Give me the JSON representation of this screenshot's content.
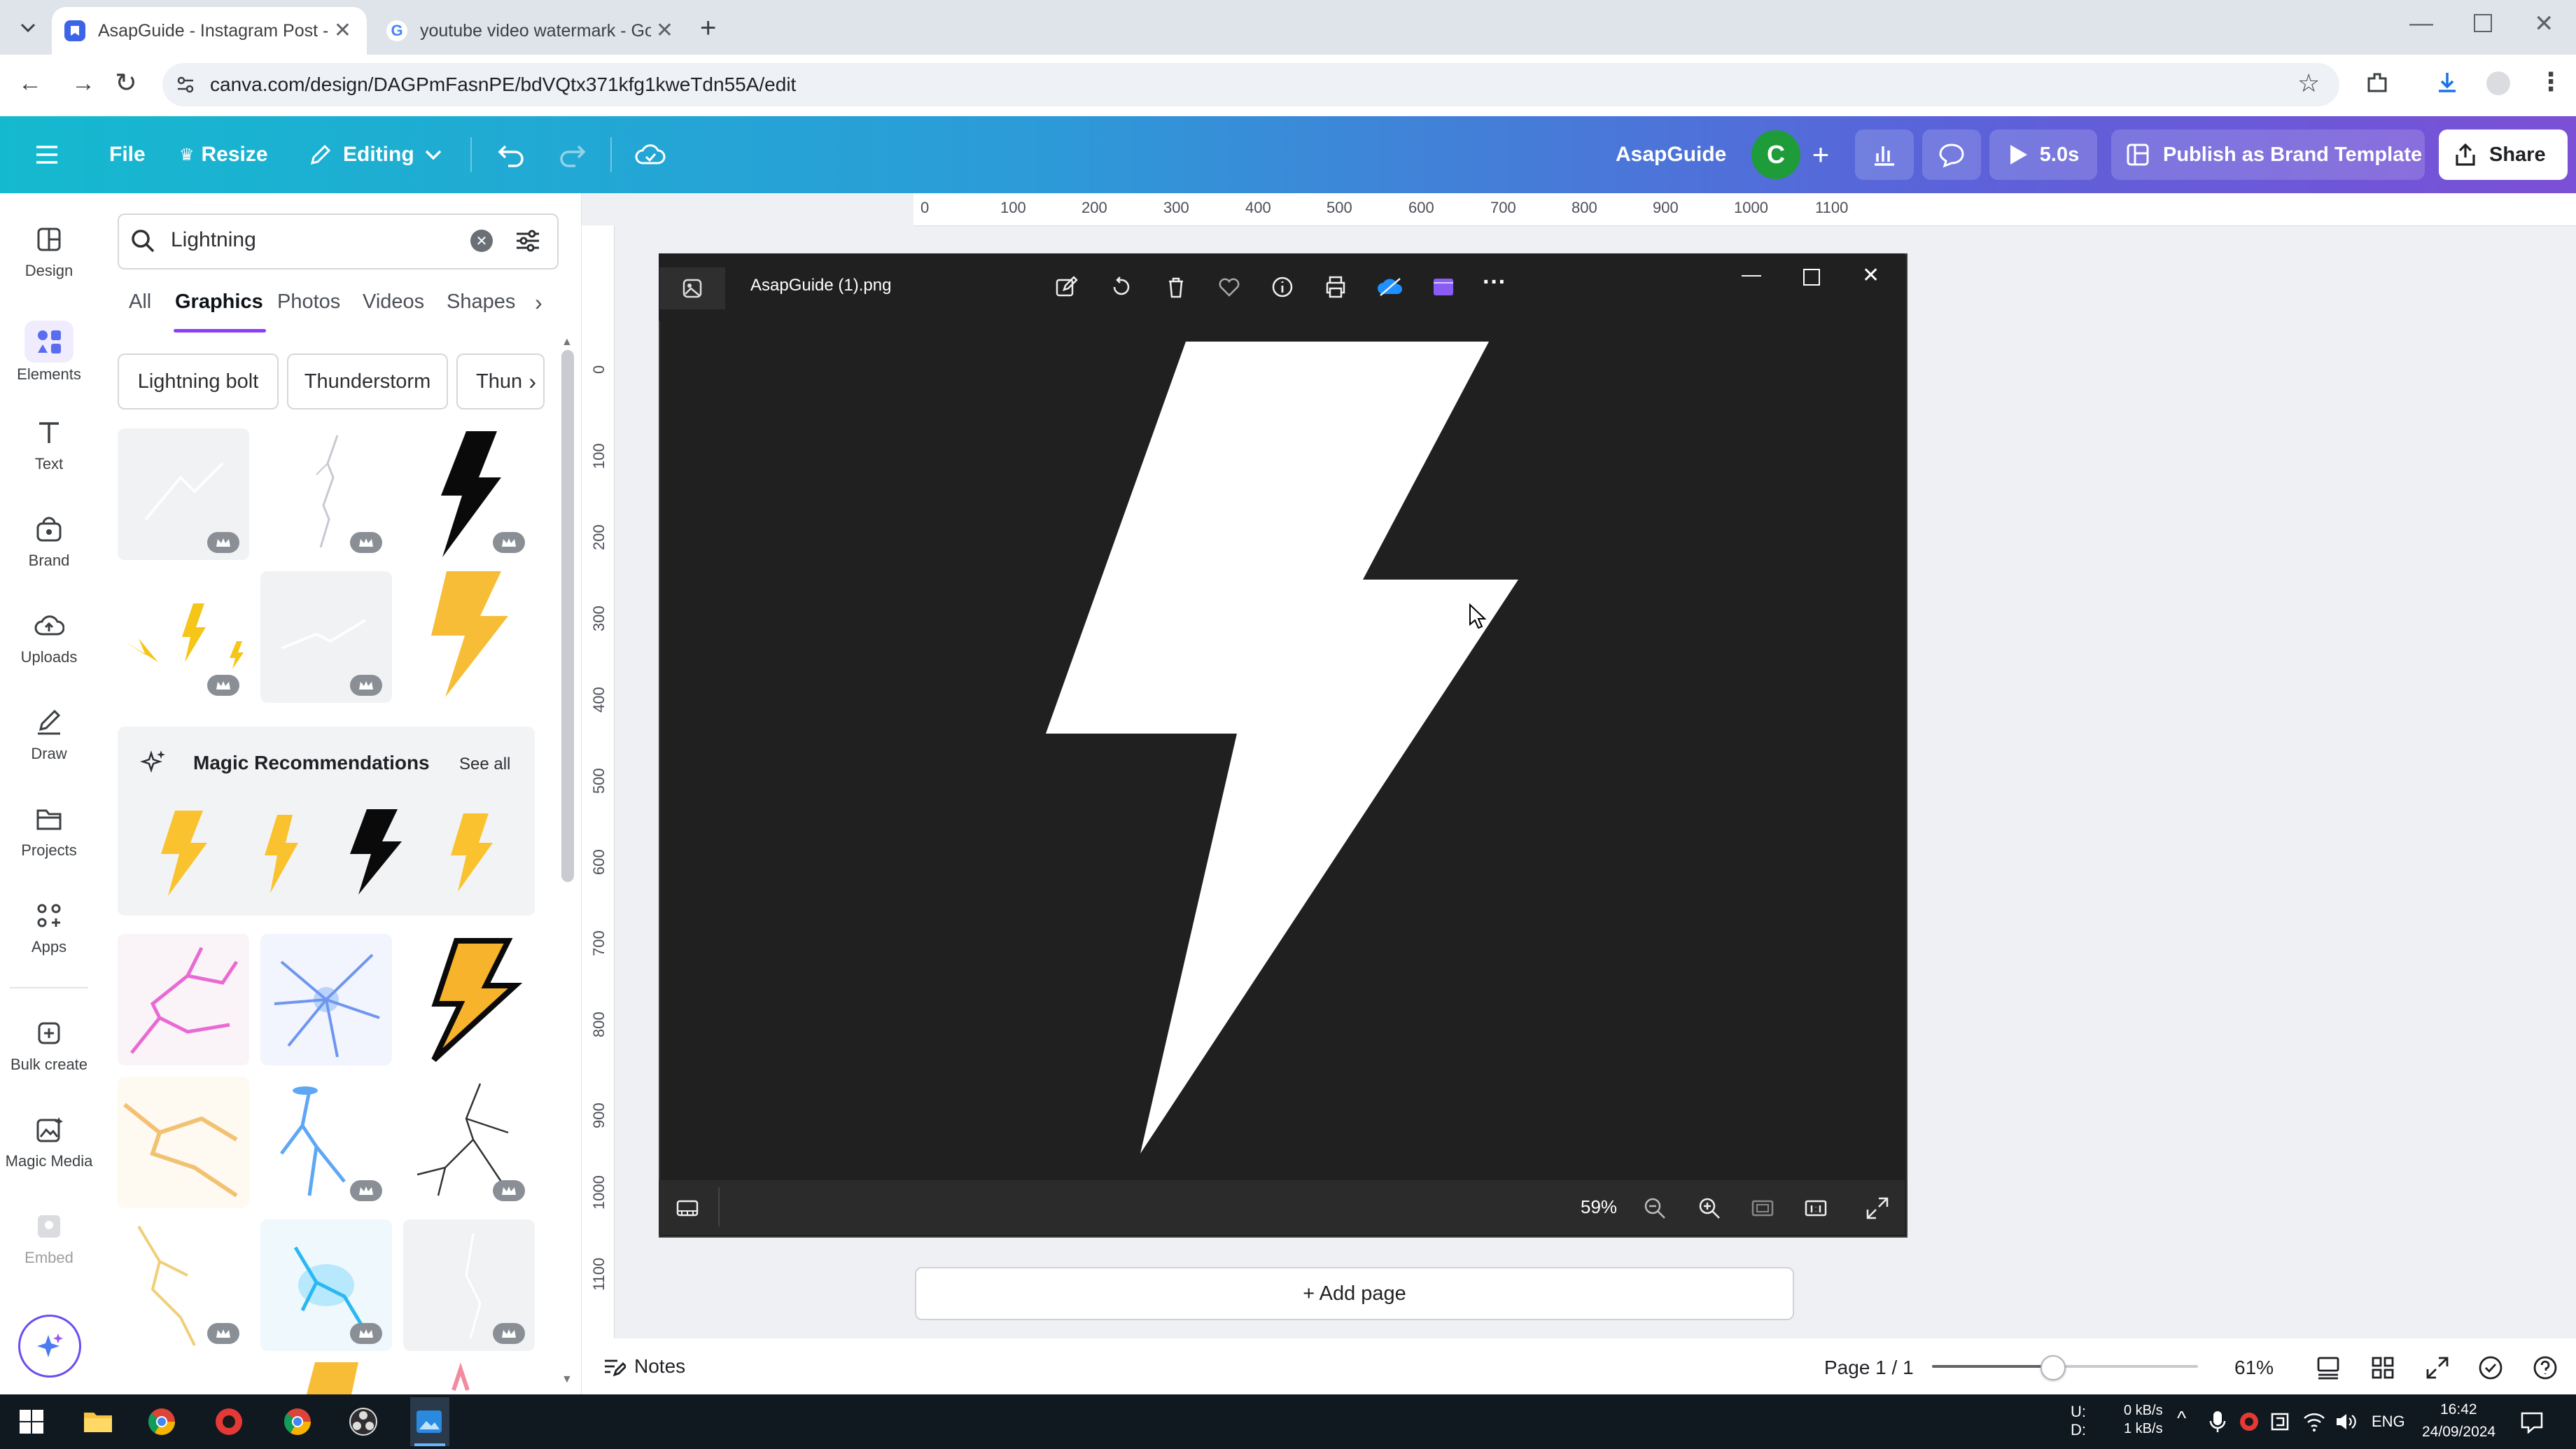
{
  "browser": {
    "tabs": [
      {
        "title": "AsapGuide - Instagram Post - C",
        "active": true
      },
      {
        "title": "youtube video watermark - Goo",
        "active": false
      }
    ],
    "url": "canva.com/design/DAGPmFasnPE/bdVQtx371kfg1kweTdn55A/edit"
  },
  "canva_header": {
    "file": "File",
    "resize": "Resize",
    "editing": "Editing",
    "project_name": "AsapGuide",
    "avatar_letter": "C",
    "play_duration": "5.0s",
    "publish": "Publish as Brand Template",
    "share": "Share"
  },
  "left_rail": [
    {
      "label": "Design",
      "icon": "design-icon"
    },
    {
      "label": "Elements",
      "icon": "elements-icon"
    },
    {
      "label": "Text",
      "icon": "text-icon"
    },
    {
      "label": "Brand",
      "icon": "brand-icon"
    },
    {
      "label": "Uploads",
      "icon": "upload-icon"
    },
    {
      "label": "Draw",
      "icon": "draw-icon"
    },
    {
      "label": "Projects",
      "icon": "folder-icon"
    },
    {
      "label": "Apps",
      "icon": "apps-icon"
    },
    {
      "label": "Bulk create",
      "icon": "bulk-create-icon"
    },
    {
      "label": "Magic Media",
      "icon": "magic-media-icon"
    },
    {
      "label": "Embed",
      "icon": "embed-icon"
    }
  ],
  "side_panel": {
    "search_value": "Lightning",
    "filter_tabs": [
      "All",
      "Graphics",
      "Photos",
      "Videos",
      "Shapes"
    ],
    "active_tab": "Graphics",
    "chips": [
      "Lightning bolt",
      "Thunderstorm",
      "Thun"
    ],
    "magic_recommendations": {
      "title": "Magic Recommendations",
      "see_all": "See all"
    }
  },
  "rulers": {
    "horizontal": [
      "0",
      "100",
      "200",
      "300",
      "400",
      "500",
      "600",
      "700",
      "800",
      "900",
      "1000",
      "1100"
    ],
    "vertical": [
      "0",
      "100",
      "200",
      "300",
      "400",
      "500",
      "600",
      "700",
      "800",
      "900",
      "1000",
      "1100"
    ]
  },
  "viewer": {
    "filename": "AsapGuide (1).png",
    "zoom": "59%"
  },
  "canvas": {
    "add_page": "+ Add page",
    "notes": "Notes",
    "page_indicator": "Page 1 / 1",
    "zoom": "61%",
    "zoom_level": 0.45
  },
  "taskbar": {
    "network_labels": "U:\nD:",
    "upload": "0 kB/s",
    "download": "1 kB/s",
    "language": "ENG",
    "time": "16:42",
    "date": "24/09/2024"
  },
  "colors": {
    "accent": "#8b3dff",
    "header_start": "#15b9cf",
    "header_end": "#7b4fd6",
    "avatar": "#1e9c3a",
    "viewer_bg": "#202020"
  }
}
